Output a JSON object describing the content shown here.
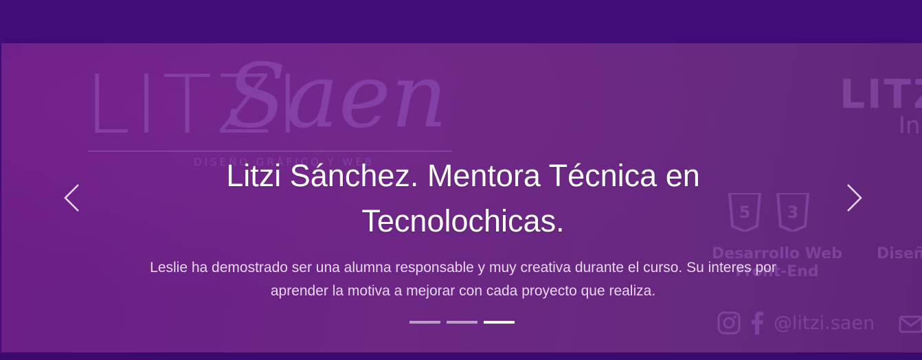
{
  "carousel": {
    "background_logo": {
      "caps": "LITZI",
      "script": "Saen",
      "subtitle": "DISEÑO GRÁFICO Y WEB"
    },
    "background_card": {
      "title": "LITZI",
      "subtitle": "Ing",
      "dev_label": "Desarrollo Web Front-End",
      "design_label": "Diseñ",
      "handle": "@litzi.saen"
    },
    "slide": {
      "title": "Litzi Sánchez. Mentora Técnica en Tecnolochicas.",
      "description": "Leslie ha demostrado ser una alumna responsable y muy creativa durante el curso. Su interes por aprender la motiva a mejorar con cada proyecto que realiza."
    },
    "controls": {
      "prev_icon": "chevron-left-icon",
      "next_icon": "chevron-right-icon"
    },
    "indicators": {
      "count": 3,
      "active_index": 2
    }
  },
  "colors": {
    "header_bg": "#410c79",
    "slide_bg": "#6c2684",
    "text": "#ffffff"
  }
}
